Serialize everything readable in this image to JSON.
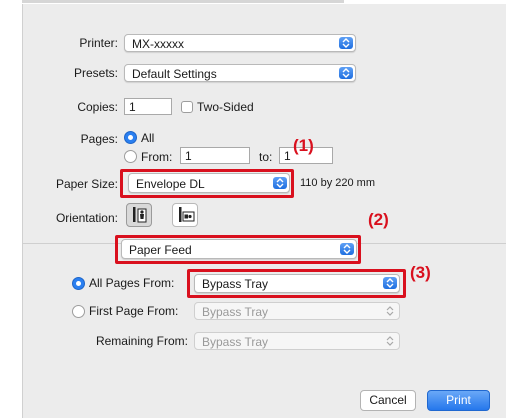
{
  "printer": {
    "label": "Printer:",
    "value": "MX-xxxxx"
  },
  "presets": {
    "label": "Presets:",
    "value": "Default Settings"
  },
  "copies": {
    "label": "Copies:",
    "value": "1",
    "two_sided_label": "Two-Sided"
  },
  "pages": {
    "label": "Pages:",
    "all_label": "All",
    "from_label": "From:",
    "from_value": "1",
    "to_label": "to:",
    "to_value": "1"
  },
  "paper_size": {
    "label": "Paper Size:",
    "value": "Envelope DL",
    "dimensions": "110 by 220 mm"
  },
  "orientation": {
    "label": "Orientation:"
  },
  "section_popup": {
    "value": "Paper Feed"
  },
  "paper_feed": {
    "all_pages_label": "All Pages From:",
    "all_pages_value": "Bypass Tray",
    "first_page_label": "First Page From:",
    "first_page_value": "Bypass Tray",
    "remaining_label": "Remaining From:",
    "remaining_value": "Bypass Tray"
  },
  "buttons": {
    "cancel": "Cancel",
    "print": "Print"
  },
  "callouts": {
    "c1": "(1)",
    "c2": "(2)",
    "c3": "(3)"
  },
  "colors": {
    "accent": "#2a7ff0",
    "highlight": "#d9101e",
    "dialog_bg": "#ececec"
  }
}
